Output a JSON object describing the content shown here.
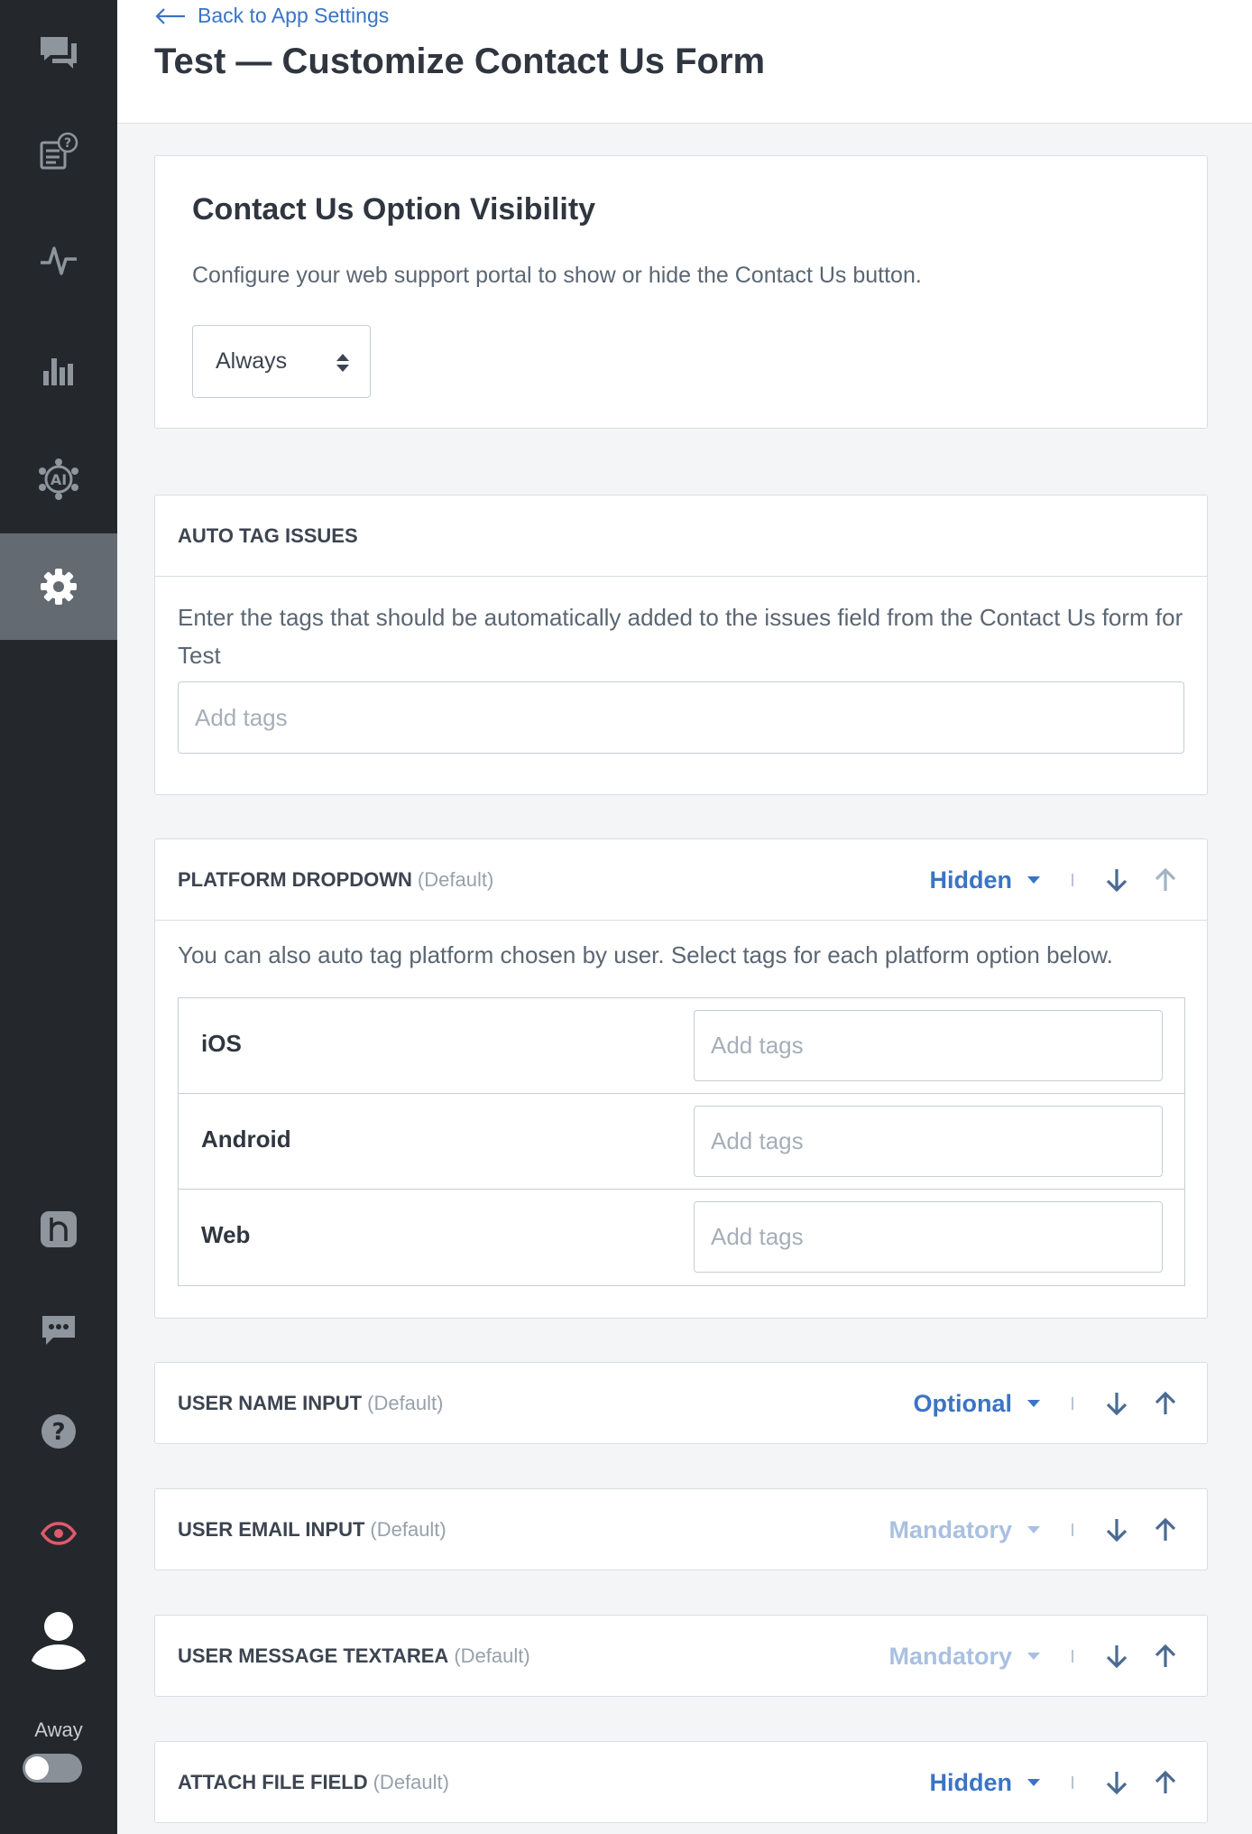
{
  "header": {
    "back_label": "Back to App Settings",
    "title": "Test — Customize Contact Us Form"
  },
  "sidebar": {
    "items": [
      {
        "icon": "chat-bubbles-icon",
        "active": false
      },
      {
        "icon": "faq-icon",
        "active": false
      },
      {
        "icon": "activity-icon",
        "active": false
      },
      {
        "icon": "analytics-icon",
        "active": false
      },
      {
        "icon": "ai-icon",
        "active": false
      },
      {
        "icon": "gear-icon",
        "active": true
      },
      {
        "icon": "helpshift-logo-icon",
        "active": false
      },
      {
        "icon": "message-icon",
        "active": false
      },
      {
        "icon": "help-icon",
        "active": false
      },
      {
        "icon": "eye-icon",
        "active": false
      },
      {
        "icon": "avatar-icon",
        "active": false
      }
    ],
    "status_label": "Away"
  },
  "visibility": {
    "title": "Contact Us Option Visibility",
    "description": "Configure your web support portal to show or hide the Contact Us button.",
    "selected": "Always"
  },
  "auto_tag": {
    "title": "AUTO TAG ISSUES",
    "description": "Enter the tags that should be automatically added to the issues field from the Contact Us form for Test",
    "placeholder": "Add tags"
  },
  "platform": {
    "title": "PLATFORM DROPDOWN",
    "default_label": "(Default)",
    "status": "Hidden",
    "description": "You can also auto tag platform chosen by user. Select tags for each platform option below.",
    "rows": [
      {
        "name": "iOS",
        "placeholder": "Add tags"
      },
      {
        "name": "Android",
        "placeholder": "Add tags"
      },
      {
        "name": "Web",
        "placeholder": "Add tags"
      }
    ]
  },
  "fields": [
    {
      "title": "USER NAME INPUT",
      "default_label": "(Default)",
      "status": "Optional",
      "enabled": true
    },
    {
      "title": "USER EMAIL INPUT",
      "default_label": "(Default)",
      "status": "Mandatory",
      "enabled": false
    },
    {
      "title": "USER MESSAGE TEXTAREA",
      "default_label": "(Default)",
      "status": "Mandatory",
      "enabled": false
    },
    {
      "title": "ATTACH FILE FIELD",
      "default_label": "(Default)",
      "status": "Hidden",
      "enabled": true
    }
  ],
  "colors": {
    "sidebar_bg": "#24282d",
    "accent_blue": "#3a74c4",
    "muted_blue": "#a9c0e0",
    "eye_red": "#e05a6a"
  }
}
